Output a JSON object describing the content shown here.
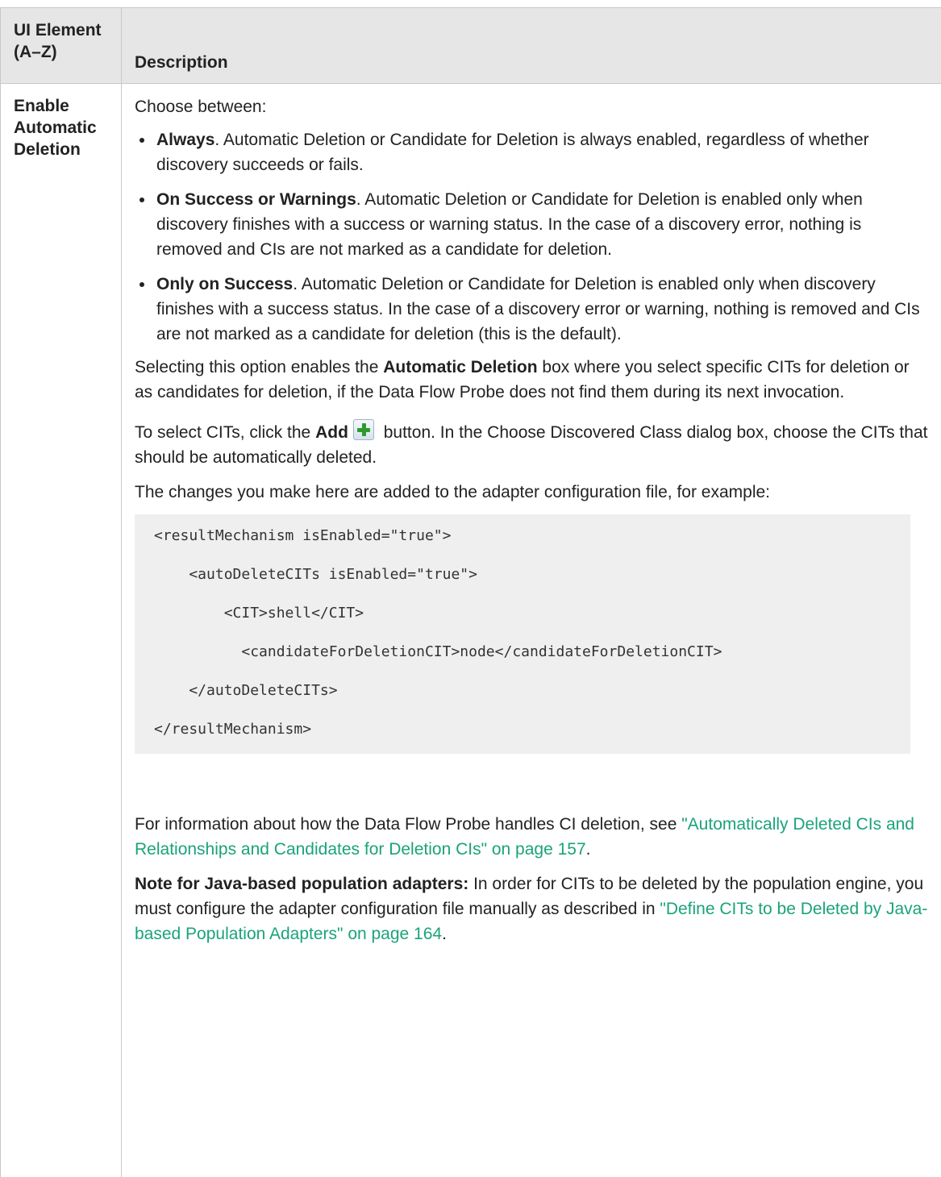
{
  "table": {
    "header": {
      "col1": "UI Element (A–Z)",
      "col2": "Description"
    },
    "row": {
      "name": "Enable Automatic Deletion",
      "intro": "Choose between:",
      "options": [
        {
          "label": "Always",
          "text": ". Automatic Deletion or Candidate for Deletion is always enabled, regardless of whether discovery succeeds or fails."
        },
        {
          "label": "On Success or Warnings",
          "text": ". Automatic Deletion or Candidate for Deletion is enabled only when discovery finishes with a success or warning status. In the case of a discovery error, nothing is removed and CIs are not marked as a candidate for deletion."
        },
        {
          "label": "Only on Success",
          "text": ". Automatic Deletion or Candidate for Deletion is enabled only when discovery finishes with a success status. In the case of a discovery error or warning, nothing is removed and CIs are not marked as a candidate for deletion (this is the default)."
        }
      ],
      "selecting_pre": "Selecting this option enables the ",
      "selecting_bold": "Automatic Deletion",
      "selecting_post": " box where you select specific CITs for deletion or as candidates for deletion, if the Data Flow Probe does not find them during its next invocation.",
      "select_pre": "To select CITs, click the ",
      "select_bold": "Add",
      "select_post": " button. In the Choose Discovered Class dialog box, choose the CITs that should be automatically deleted.",
      "changes": "The changes you make here are added to the adapter configuration file, for example:",
      "code": [
        "<resultMechanism isEnabled=\"true\">",
        "    <autoDeleteCITs isEnabled=\"true\">",
        "        <CIT>shell</CIT>",
        "          <candidateForDeletionCIT>node</candidateForDeletionCIT>",
        "    </autoDeleteCITs>",
        "</resultMechanism>"
      ],
      "info_pre": "For information about how the Data Flow Probe handles CI deletion, see ",
      "info_link": "\"Automatically Deleted CIs and Relationships and Candidates for Deletion CIs\" on page 157",
      "info_post": ".",
      "note_bold": "Note for Java-based population adapters:",
      "note_text": " In order for CITs to be deleted by the population engine, you must configure the adapter configuration file manually as described in ",
      "note_link": "\"Define CITs to be Deleted by Java-based Population Adapters\" on page 164",
      "note_post": "."
    }
  },
  "colors": {
    "header_bg": "#e6e6e6",
    "border": "#c8c8c8",
    "link": "#1aa37a",
    "code_bg": "#efefef"
  },
  "icons": {
    "add_button": "add-plus-icon"
  }
}
